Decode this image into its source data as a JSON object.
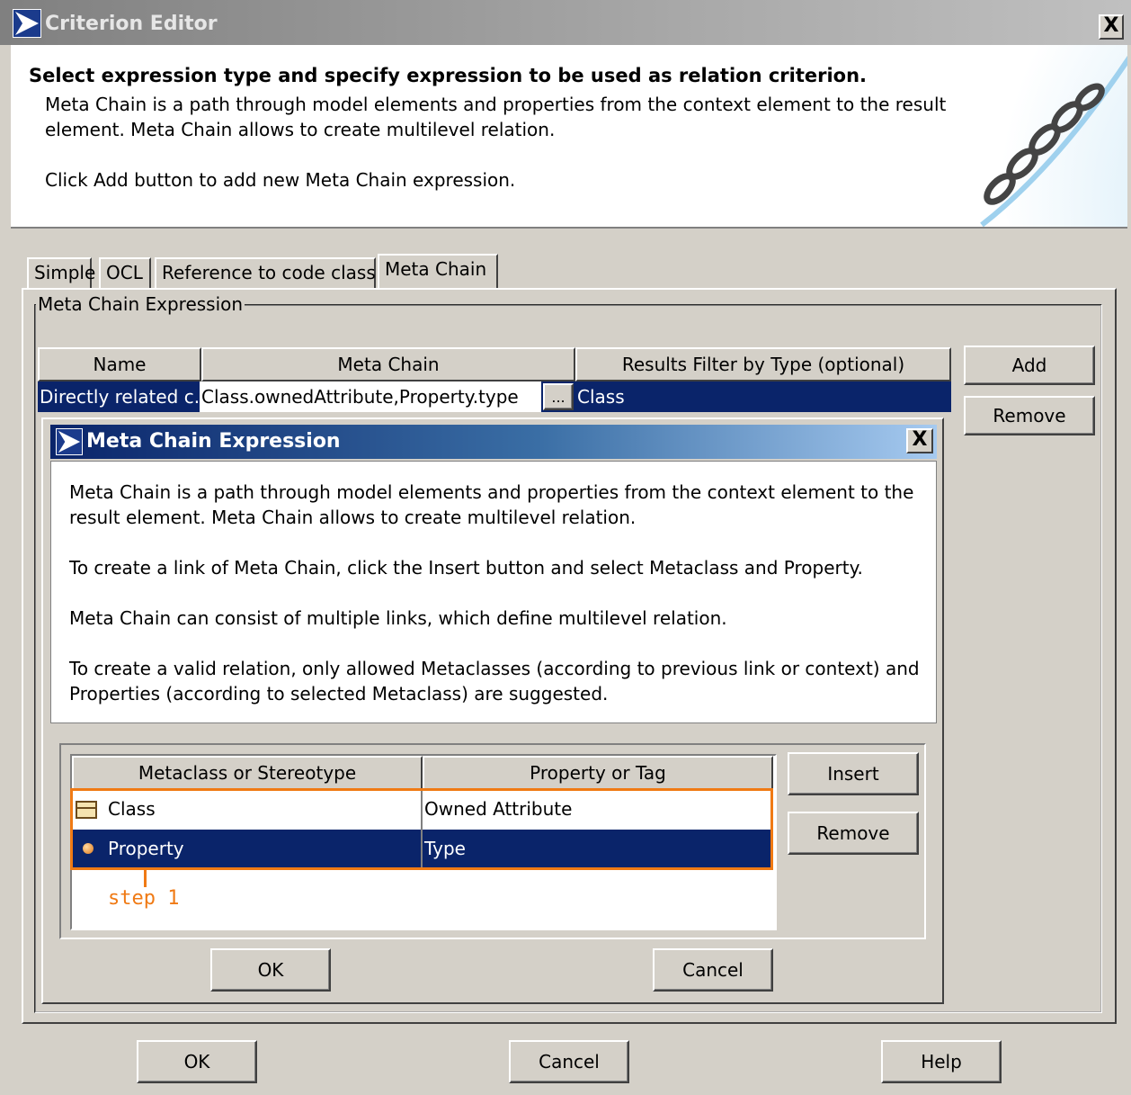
{
  "window": {
    "title": "Criterion Editor",
    "close": "X"
  },
  "header": {
    "title": "Select expression type and specify expression to be used as relation criterion.",
    "line1": "Meta Chain is a path through model elements and properties from the context element to the result",
    "line2": "element. Meta Chain allows to create multilevel relation.",
    "line3": "Click Add button to add new Meta Chain expression."
  },
  "tabs": [
    {
      "label": "Simple"
    },
    {
      "label": "OCL"
    },
    {
      "label": "Reference to code class"
    },
    {
      "label": "Meta Chain",
      "active": true
    }
  ],
  "group": {
    "legend": "Meta Chain Expression"
  },
  "expr_table": {
    "columns": [
      "Name",
      "Meta Chain",
      "Results Filter by Type (optional)"
    ],
    "rows": [
      {
        "name": "Directly related c...",
        "chain": "Class.ownedAttribute,Property.type",
        "ellipsis": "...",
        "filter": "Class"
      }
    ]
  },
  "side_buttons": {
    "add": "Add",
    "remove": "Remove"
  },
  "inner_dialog": {
    "title": "Meta Chain Expression",
    "close": "X",
    "desc1a": "Meta Chain is a path through model elements and properties from the context element to the",
    "desc1b": "result element. Meta Chain allows to create multilevel relation.",
    "desc2": "To create a link of Meta Chain, click the Insert button and select Metaclass and Property.",
    "desc3": "Meta Chain can consist of multiple links, which define multilevel relation.",
    "desc4a": "To create a valid relation, only allowed Metaclasses (according to previous link or context) and",
    "desc4b": "Properties (according to selected Metaclass) are suggested.",
    "table": {
      "columns": [
        "Metaclass or Stereotype",
        "Property or Tag"
      ],
      "rows": [
        {
          "metaclass": "Class",
          "property": "Owned Attribute",
          "icon": "class-icon"
        },
        {
          "metaclass": "Property",
          "property": "Type",
          "icon": "property-icon"
        }
      ]
    },
    "insert": "Insert",
    "remove": "Remove",
    "ok": "OK",
    "cancel": "Cancel",
    "annotation": "step 1",
    "annotation_color": "#f07a14"
  },
  "footer": {
    "ok": "OK",
    "cancel": "Cancel",
    "help": "Help"
  },
  "colors": {
    "selection": "#0a246a",
    "dialog_bg": "#d4d0c8"
  }
}
